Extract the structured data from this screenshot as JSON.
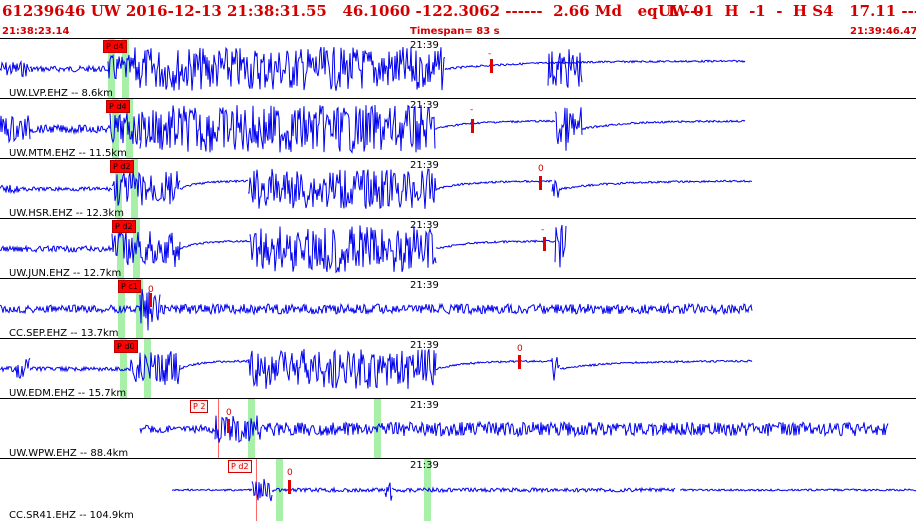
{
  "header": {
    "event_line": "61239646 UW 2016-12-13 21:38:31.55   46.1060 -122.3062 ------  2.66 Md   eq  L ---",
    "right_line": "UW 01  H  -1  -  H S4   17.11 -----",
    "start_time": "21:38:23.14",
    "timespan": "Timespan=  83 s",
    "end_time": "21:39:46.47"
  },
  "panels": [
    {
      "station": "UW.LVP.EHZ -- 8.6km",
      "minute": "21:39",
      "pick": "P d4",
      "marker": "-"
    },
    {
      "station": "UW.MTM.EHZ -- 11.5km",
      "minute": "21:39",
      "pick": "P d4",
      "marker": "-"
    },
    {
      "station": "UW.HSR.EHZ -- 12.3km",
      "minute": "21:39",
      "pick": "P d2",
      "marker": "0"
    },
    {
      "station": "UW.JUN.EHZ -- 12.7km",
      "minute": "21:39",
      "pick": "P d2",
      "marker": "-"
    },
    {
      "station": "CC.SEP.EHZ -- 13.7km",
      "minute": "21:39",
      "pick": "P c1",
      "marker": "0"
    },
    {
      "station": "UW.EDM.EHZ -- 15.7km",
      "minute": "21:39",
      "pick": "P d0",
      "marker": "0"
    },
    {
      "station": "UW.WPW.EHZ -- 88.4km",
      "minute": "21:39",
      "pick": "P 2",
      "marker": "0"
    },
    {
      "station": "CC.SR41.EHZ -- 104.9km",
      "minute": "21:39",
      "pick": "P d2",
      "marker": "0"
    }
  ],
  "colors": {
    "header_text": "#d40000",
    "trace": "#0000ee",
    "pick_box": "#ff0000",
    "green_band": "#a8f0a8"
  }
}
